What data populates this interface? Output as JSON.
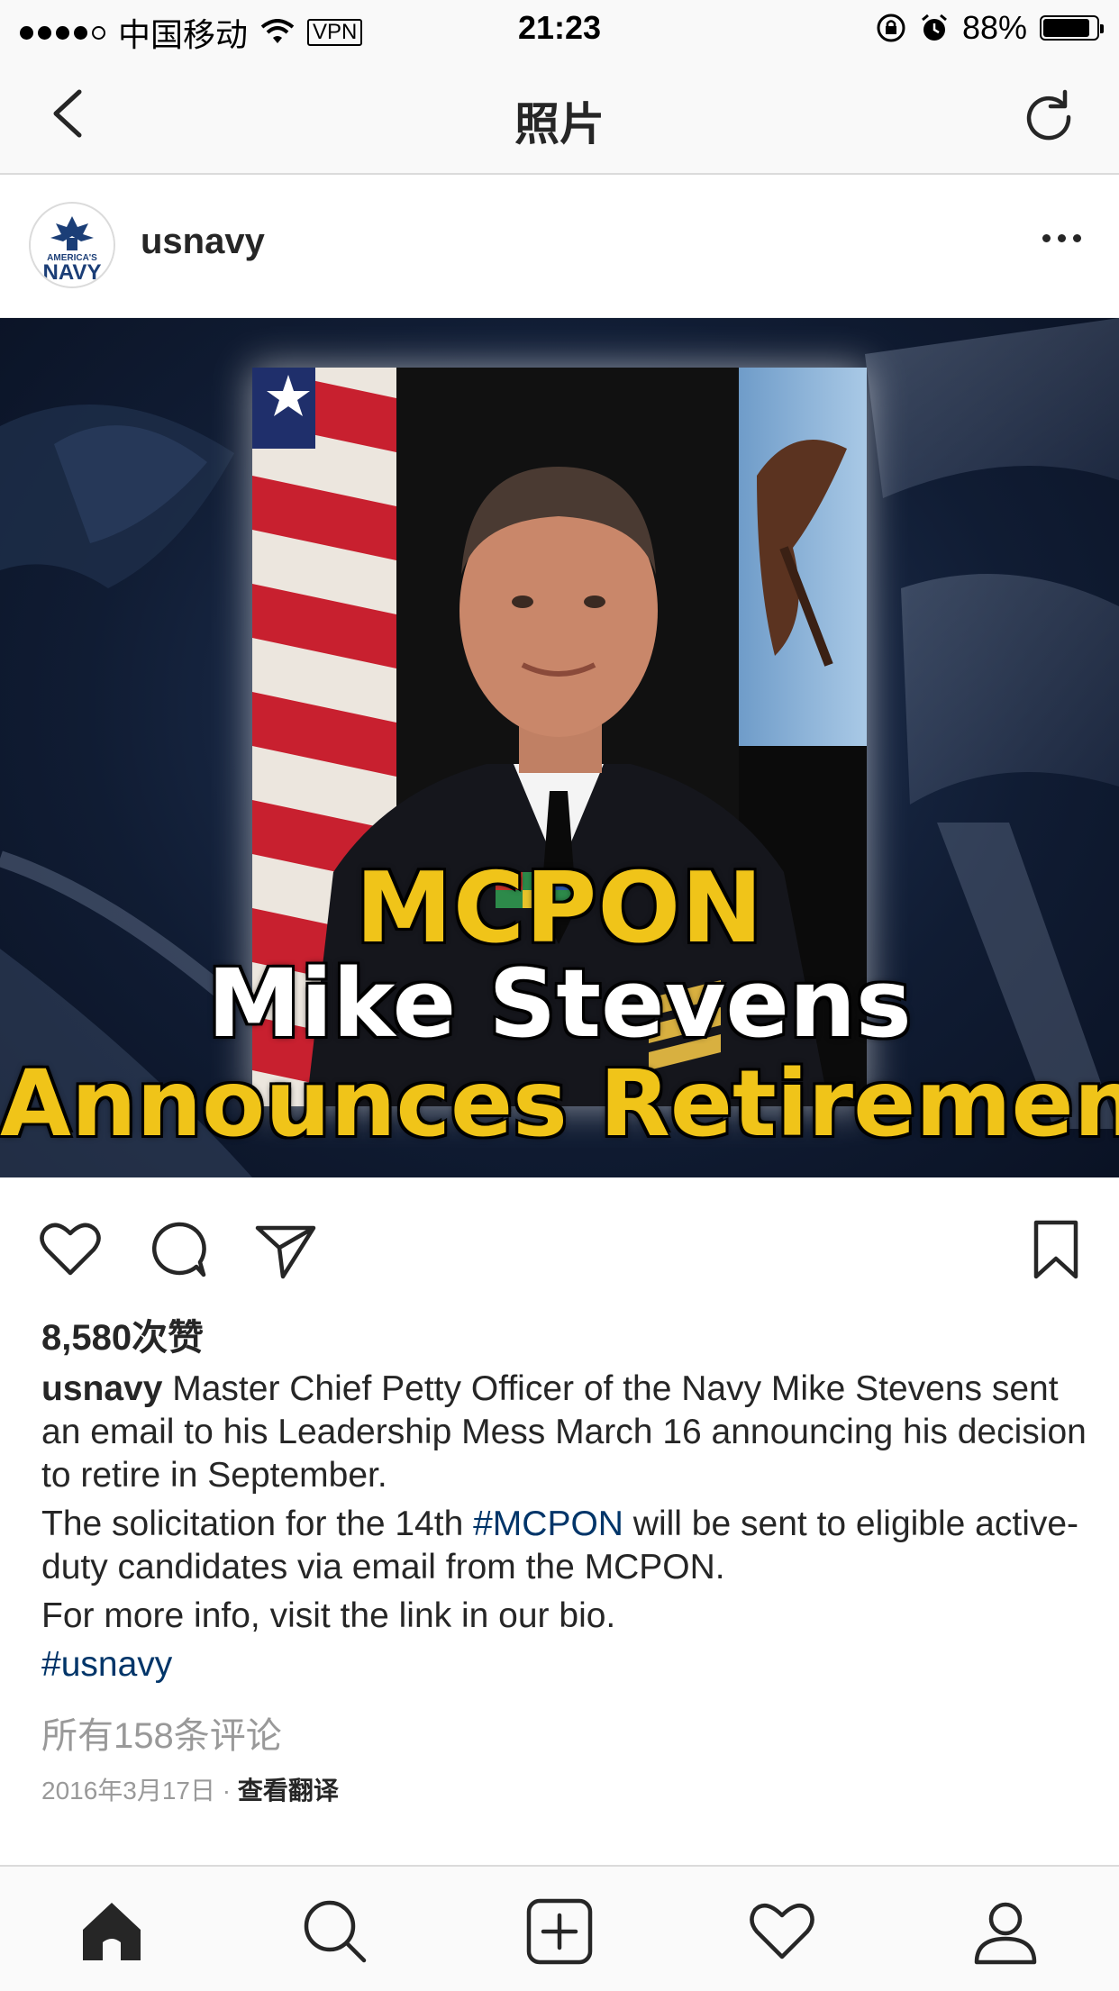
{
  "status_bar": {
    "carrier": "中国移动",
    "vpn": "VPN",
    "time": "21:23",
    "battery": "88%",
    "battery_level": 0.88
  },
  "nav": {
    "title": "照片",
    "back_icon": "chevron-left-icon",
    "refresh_icon": "refresh-icon"
  },
  "post": {
    "username": "usnavy",
    "avatar_icon": "navy-logo-icon",
    "image": {
      "line1": "MCPON",
      "line2": "Mike Stevens",
      "line3": "Announces Retirement"
    },
    "likes": "8,580次赞",
    "caption": {
      "username": "usnavy",
      "p1": " Master Chief Petty Officer of the Navy Mike Stevens sent an email to his Leadership Mess March 16 announcing his decision to retire in September.",
      "p2_before": "The solicitation for the 14th ",
      "p2_tag": "#MCPON",
      "p2_after": " will be sent to eligible active-duty candidates via email from the MCPON.",
      "p3": "For more info, visit the link in our bio.",
      "p4_tag": "#usnavy"
    },
    "comments_link": "所有158条评论",
    "date": "2016年3月17日",
    "separator": " · ",
    "translate": "查看翻译"
  },
  "tab_bar": {
    "items": [
      "home-icon",
      "search-icon",
      "add-post-icon",
      "activity-heart-icon",
      "profile-icon"
    ],
    "active": "home-icon"
  },
  "colors": {
    "hashtag": "#003569",
    "headline_yellow": "#f0c419",
    "muted": "#999999"
  }
}
